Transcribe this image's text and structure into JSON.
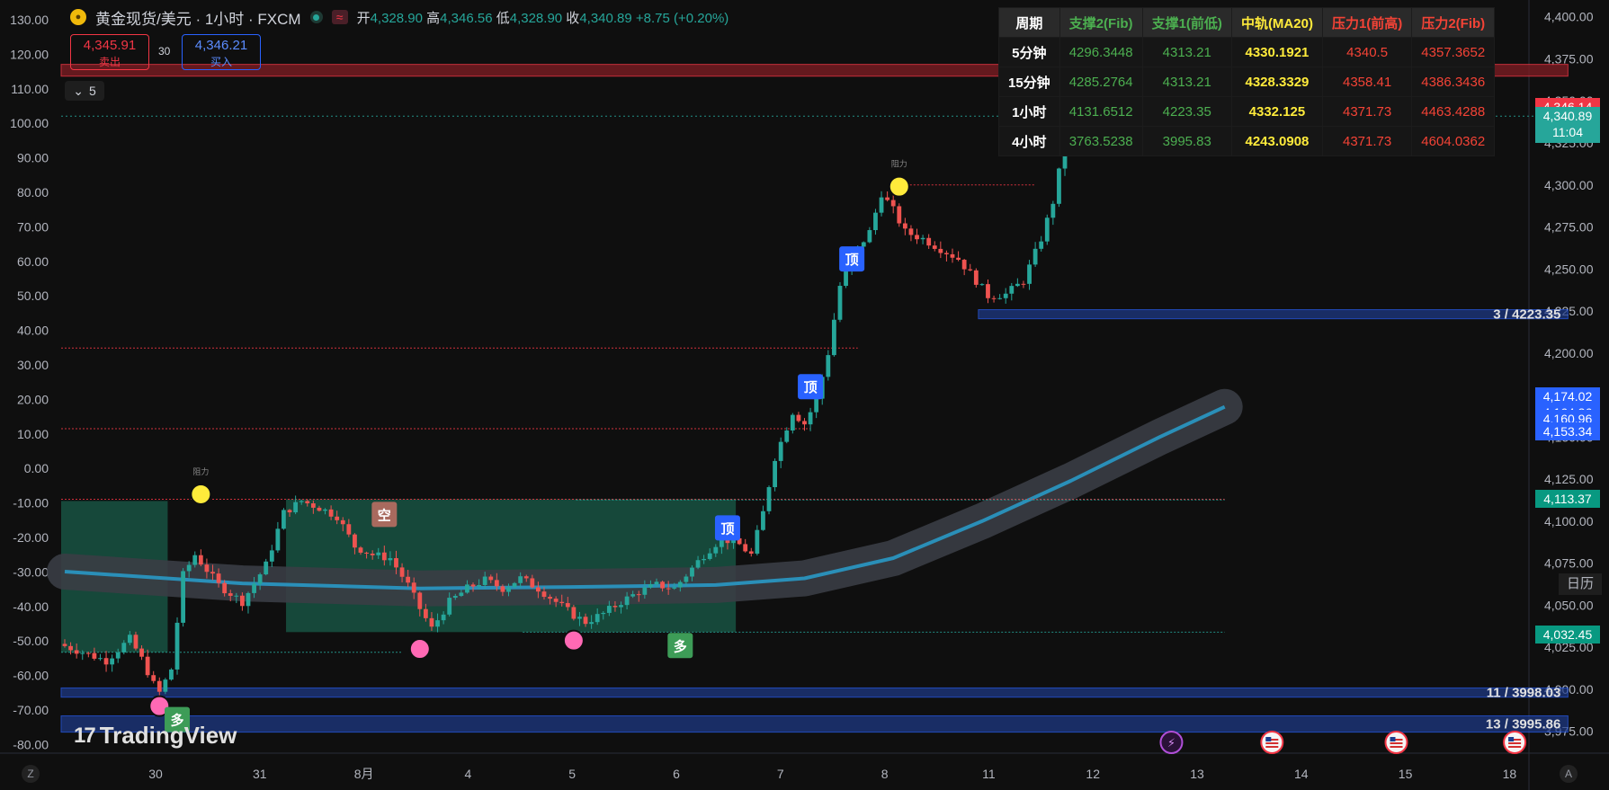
{
  "header": {
    "symbol_title": "黄金现货/美元 · 1小时 · FXCM",
    "symbol_icon": "gold-coin-icon",
    "ohlc": [
      {
        "label": "开",
        "value": "4,328.90"
      },
      {
        "label": "高",
        "value": "4,346.56"
      },
      {
        "label": "低",
        "value": "4,328.90"
      },
      {
        "label": "收",
        "value": "4,340.89"
      }
    ],
    "change": "+8.75 (+0.20%)"
  },
  "trade": {
    "sell_price": "4,345.91",
    "sell_label": "卖出",
    "buy_price": "4,346.21",
    "buy_label": "买入",
    "spread": "30"
  },
  "indicator_toggle": {
    "count": "5"
  },
  "table": {
    "headers": [
      "周期",
      "支撑2(Fib)",
      "支撑1(前低)",
      "中轨(MA20)",
      "压力1(前高)",
      "压力2(Fib)"
    ],
    "rows": [
      [
        "5分钟",
        "4296.3448",
        "4313.21",
        "4330.1921",
        "4340.5",
        "4357.3652"
      ],
      [
        "15分钟",
        "4285.2764",
        "4313.21",
        "4328.3329",
        "4358.41",
        "4386.3436"
      ],
      [
        "1小时",
        "4131.6512",
        "4223.35",
        "4332.125",
        "4371.73",
        "4463.4288"
      ],
      [
        "4小时",
        "3763.5238",
        "3995.83",
        "4243.0908",
        "4371.73",
        "4604.0362"
      ]
    ]
  },
  "watermark": "TradingView",
  "calendar_button": "日历",
  "colors": {
    "up": "#26a69a",
    "down": "#ef5350",
    "bg": "#0f0f0f",
    "zone_blue": "#1e3a8a",
    "zone_red": "#7a1c22",
    "accent": "#2962ff"
  },
  "chart_data": {
    "type": "candlestick",
    "symbol": "XAUUSD",
    "interval": "1小时",
    "y_axis_right": {
      "ticks": [
        3975,
        4000,
        4025,
        4050,
        4075,
        4100,
        4125,
        4150,
        4175,
        4200,
        4225,
        4250,
        4275,
        4300,
        4325,
        4350,
        4375,
        4400
      ]
    },
    "y_axis_left": {
      "ticks": [
        130,
        120,
        110,
        100,
        90,
        80,
        70,
        60,
        50,
        40,
        30,
        20,
        10,
        0,
        -10,
        -20,
        -30,
        -40,
        -50,
        -60,
        -70,
        -80
      ]
    },
    "x_axis": {
      "ticks": [
        "30",
        "31",
        "8月",
        "4",
        "5",
        "6",
        "7",
        "8",
        "11",
        "12",
        "13",
        "14",
        "15",
        "18"
      ]
    },
    "price_path": [
      [
        0,
        4027
      ],
      [
        4,
        4022
      ],
      [
        8,
        4017
      ],
      [
        12,
        4030
      ],
      [
        14,
        4018
      ],
      [
        16,
        4003
      ],
      [
        17,
        3998
      ],
      [
        19,
        4012
      ],
      [
        21,
        4068
      ],
      [
        23,
        4080
      ],
      [
        27,
        4062
      ],
      [
        31,
        4052
      ],
      [
        35,
        4074
      ],
      [
        38,
        4105
      ],
      [
        41,
        4112
      ],
      [
        44,
        4108
      ],
      [
        47,
        4103
      ],
      [
        50,
        4085
      ],
      [
        53,
        4080
      ],
      [
        56,
        4078
      ],
      [
        59,
        4062
      ],
      [
        61,
        4048
      ],
      [
        63,
        4036
      ],
      [
        66,
        4052
      ],
      [
        69,
        4060
      ],
      [
        72,
        4065
      ],
      [
        75,
        4060
      ],
      [
        78,
        4066
      ],
      [
        81,
        4060
      ],
      [
        84,
        4052
      ],
      [
        87,
        4044
      ],
      [
        89,
        4040
      ],
      [
        92,
        4045
      ],
      [
        95,
        4052
      ],
      [
        98,
        4058
      ],
      [
        101,
        4062
      ],
      [
        104,
        4060
      ],
      [
        106,
        4068
      ],
      [
        109,
        4080
      ],
      [
        112,
        4090
      ],
      [
        115,
        4086
      ],
      [
        117,
        4080
      ],
      [
        119,
        4105
      ],
      [
        121,
        4138
      ],
      [
        124,
        4165
      ],
      [
        126,
        4158
      ],
      [
        128,
        4172
      ],
      [
        130,
        4200
      ],
      [
        132,
        4240
      ],
      [
        135,
        4262
      ],
      [
        137,
        4272
      ],
      [
        139,
        4295
      ],
      [
        141,
        4285
      ],
      [
        143,
        4272
      ],
      [
        146,
        4268
      ],
      [
        149,
        4262
      ],
      [
        152,
        4256
      ],
      [
        155,
        4243
      ],
      [
        157,
        4234
      ],
      [
        160,
        4235
      ],
      [
        163,
        4243
      ],
      [
        166,
        4268
      ],
      [
        168,
        4290
      ],
      [
        170,
        4325
      ],
      [
        172,
        4368
      ],
      [
        174,
        4340
      ],
      [
        177,
        4336
      ],
      [
        180,
        4337
      ],
      [
        183,
        4334
      ],
      [
        186,
        4326
      ],
      [
        189,
        4332
      ],
      [
        190,
        4340.89
      ]
    ],
    "price_range": [
      3962,
      4410
    ],
    "bar_count": 190,
    "last_price": 4340.89,
    "price_labels": [
      {
        "value": "4,346.14",
        "price": 4346.14,
        "color": "#f23645"
      },
      {
        "value": "4,340.89",
        "price": 4340.89,
        "color": "#26a69a",
        "sub": "11:04"
      },
      {
        "value": "4,174.02",
        "price": 4174.02,
        "color": "#2962ff"
      },
      {
        "value": "4,164.36",
        "price": 4164.36,
        "color": "#2962ff"
      },
      {
        "value": "4,160.96",
        "price": 4160.96,
        "color": "#2962ff"
      },
      {
        "value": "4,153.34",
        "price": 4153.34,
        "color": "#2962ff"
      },
      {
        "value": "4,113.37",
        "price": 4113.37,
        "color": "#089981"
      },
      {
        "value": "4,032.45",
        "price": 4032.45,
        "color": "#089981"
      }
    ],
    "zones": [
      {
        "label": "",
        "price_top": 4371.7,
        "price_bottom": 4364.7,
        "bar_from": 0,
        "bar_to": 254,
        "kind": "resistance"
      },
      {
        "label": "3 / 4223.35",
        "price_top": 4225.8,
        "price_bottom": 4220.4,
        "bar_from": 155,
        "bar_to": 254,
        "kind": "support"
      },
      {
        "label": "11 / 3998.03",
        "price_top": 4000.8,
        "price_bottom": 3995.3,
        "bar_from": 0,
        "bar_to": 254,
        "kind": "support"
      },
      {
        "label": "13 / 3995.86",
        "price_top": 3984.2,
        "price_bottom": 3974.5,
        "bar_from": 0,
        "bar_to": 254,
        "kind": "support"
      }
    ],
    "zone_text_15min": "4369.48",
    "boxes": [
      {
        "bar_from": 0,
        "bar_to": 18,
        "price_top": 4112,
        "price_bottom": 4022,
        "color": "#1a5c4a"
      },
      {
        "bar_from": 38,
        "bar_to": 114,
        "price_top": 4113,
        "price_bottom": 4034,
        "color": "#1a5c4a"
      }
    ],
    "h_lines": [
      {
        "price": 4113,
        "bar_from": 0,
        "bar_to": 196,
        "color": "#f23645"
      },
      {
        "price": 4112.6,
        "bar_from": 87,
        "bar_to": 196,
        "color": "#26a69a"
      },
      {
        "price": 4034,
        "bar_from": 78,
        "bar_to": 196,
        "color": "#26a69a"
      },
      {
        "price": 4022,
        "bar_from": 0,
        "bar_to": 57,
        "color": "#26a69a"
      },
      {
        "price": 4203,
        "bar_from": 0,
        "bar_to": 134,
        "color": "#f23645"
      },
      {
        "price": 4155,
        "bar_from": 0,
        "bar_to": 126,
        "color": "#f23645"
      },
      {
        "price": 4300,
        "bar_from": 141,
        "bar_to": 164,
        "color": "#f23645"
      },
      {
        "price": 4340.9,
        "bar_from": 0,
        "bar_to": 254,
        "color": "#26a69a"
      }
    ],
    "ma_band": [
      [
        0,
        4070
      ],
      [
        30,
        4063
      ],
      [
        60,
        4060
      ],
      [
        90,
        4061
      ],
      [
        110,
        4062
      ],
      [
        125,
        4066
      ],
      [
        140,
        4078
      ],
      [
        155,
        4100
      ],
      [
        170,
        4124
      ],
      [
        185,
        4150
      ],
      [
        196,
        4168
      ]
    ],
    "markers": [
      {
        "type": "circle",
        "color": "#ffeb3b",
        "bar": 23,
        "price": 4116,
        "label": "阻力"
      },
      {
        "type": "circle",
        "color": "#ffeb3b",
        "bar": 141,
        "price": 4299,
        "label": "阻力"
      },
      {
        "type": "circle",
        "color": "#ffeb3b",
        "bar": 172,
        "price": 4376,
        "label": "阻力"
      },
      {
        "type": "circle",
        "color": "#ff69b4",
        "bar": 16,
        "price": 3990
      },
      {
        "type": "circle",
        "color": "#ff69b4",
        "bar": 60,
        "price": 4024
      },
      {
        "type": "circle",
        "color": "#ff69b4",
        "bar": 86,
        "price": 4029
      },
      {
        "type": "tag",
        "color": "#3d9c57",
        "bar": 19,
        "price": 3982,
        "label": "多"
      },
      {
        "type": "tag",
        "color": "#3d9c57",
        "bar": 104,
        "price": 4026,
        "label": "多"
      },
      {
        "type": "tag",
        "color": "#a86a5e",
        "bar": 54,
        "price": 4104,
        "label": "空"
      },
      {
        "type": "tag",
        "color": "#2962ff",
        "bar": 112,
        "price": 4096,
        "label": "顶"
      },
      {
        "type": "tag",
        "color": "#2962ff",
        "bar": 126,
        "price": 4180,
        "label": "顶"
      },
      {
        "type": "tag",
        "color": "#2962ff",
        "bar": 133,
        "price": 4256,
        "label": "顶"
      }
    ],
    "event_icons": [
      {
        "bar": 187,
        "kind": "lightning-icon"
      },
      {
        "bar": 204,
        "kind": "us-flag-icon"
      },
      {
        "bar": 225,
        "kind": "us-flag-icon"
      },
      {
        "bar": 245,
        "kind": "us-flag-icon"
      },
      {
        "bar": 265,
        "kind": "us-flag-icon"
      },
      {
        "bar": 267,
        "kind": "us-flag-icon"
      }
    ]
  }
}
